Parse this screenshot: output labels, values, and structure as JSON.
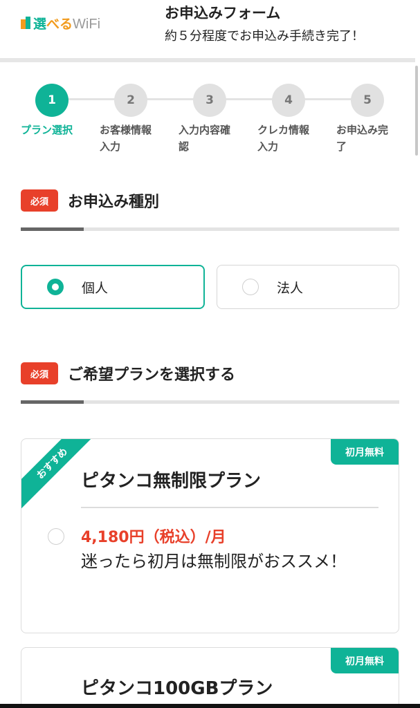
{
  "header": {
    "logo": "選べるWiFi",
    "logo_parts": [
      "選",
      "べる",
      "WiFi"
    ],
    "title": "お申込みフォーム",
    "subtitle": "約５分程度でお申込み手続き完了！"
  },
  "steps": [
    {
      "number": "1",
      "label": "プラン選択",
      "active": true
    },
    {
      "number": "2",
      "label": "お客様情報入力",
      "active": false
    },
    {
      "number": "3",
      "label": "入力内容確認",
      "active": false
    },
    {
      "number": "4",
      "label": "クレカ情報入力",
      "active": false
    },
    {
      "number": "5",
      "label": "お申込み完了",
      "active": false
    }
  ],
  "sections": {
    "type": {
      "badge": "必須",
      "title": "お申込み種別"
    },
    "plan": {
      "badge": "必須",
      "title": "ご希望プランを選択する"
    }
  },
  "type_options": [
    {
      "label": "個人",
      "selected": true
    },
    {
      "label": "法人",
      "selected": false
    }
  ],
  "plans": [
    {
      "ribbon": "おすすめ",
      "badge": "初月無料",
      "name": "ピタンコ無制限プラン",
      "price": "4,180円（税込）/月",
      "desc": "迷ったら初月は無制限がおススメ！",
      "selected": false
    },
    {
      "badge": "初月無料",
      "name": "ピタンコ100GBプラン"
    }
  ],
  "colors": {
    "accent": "#0fb397",
    "required": "#e8402a",
    "price": "#e8402a",
    "logo_orange": "#f29b1d"
  }
}
